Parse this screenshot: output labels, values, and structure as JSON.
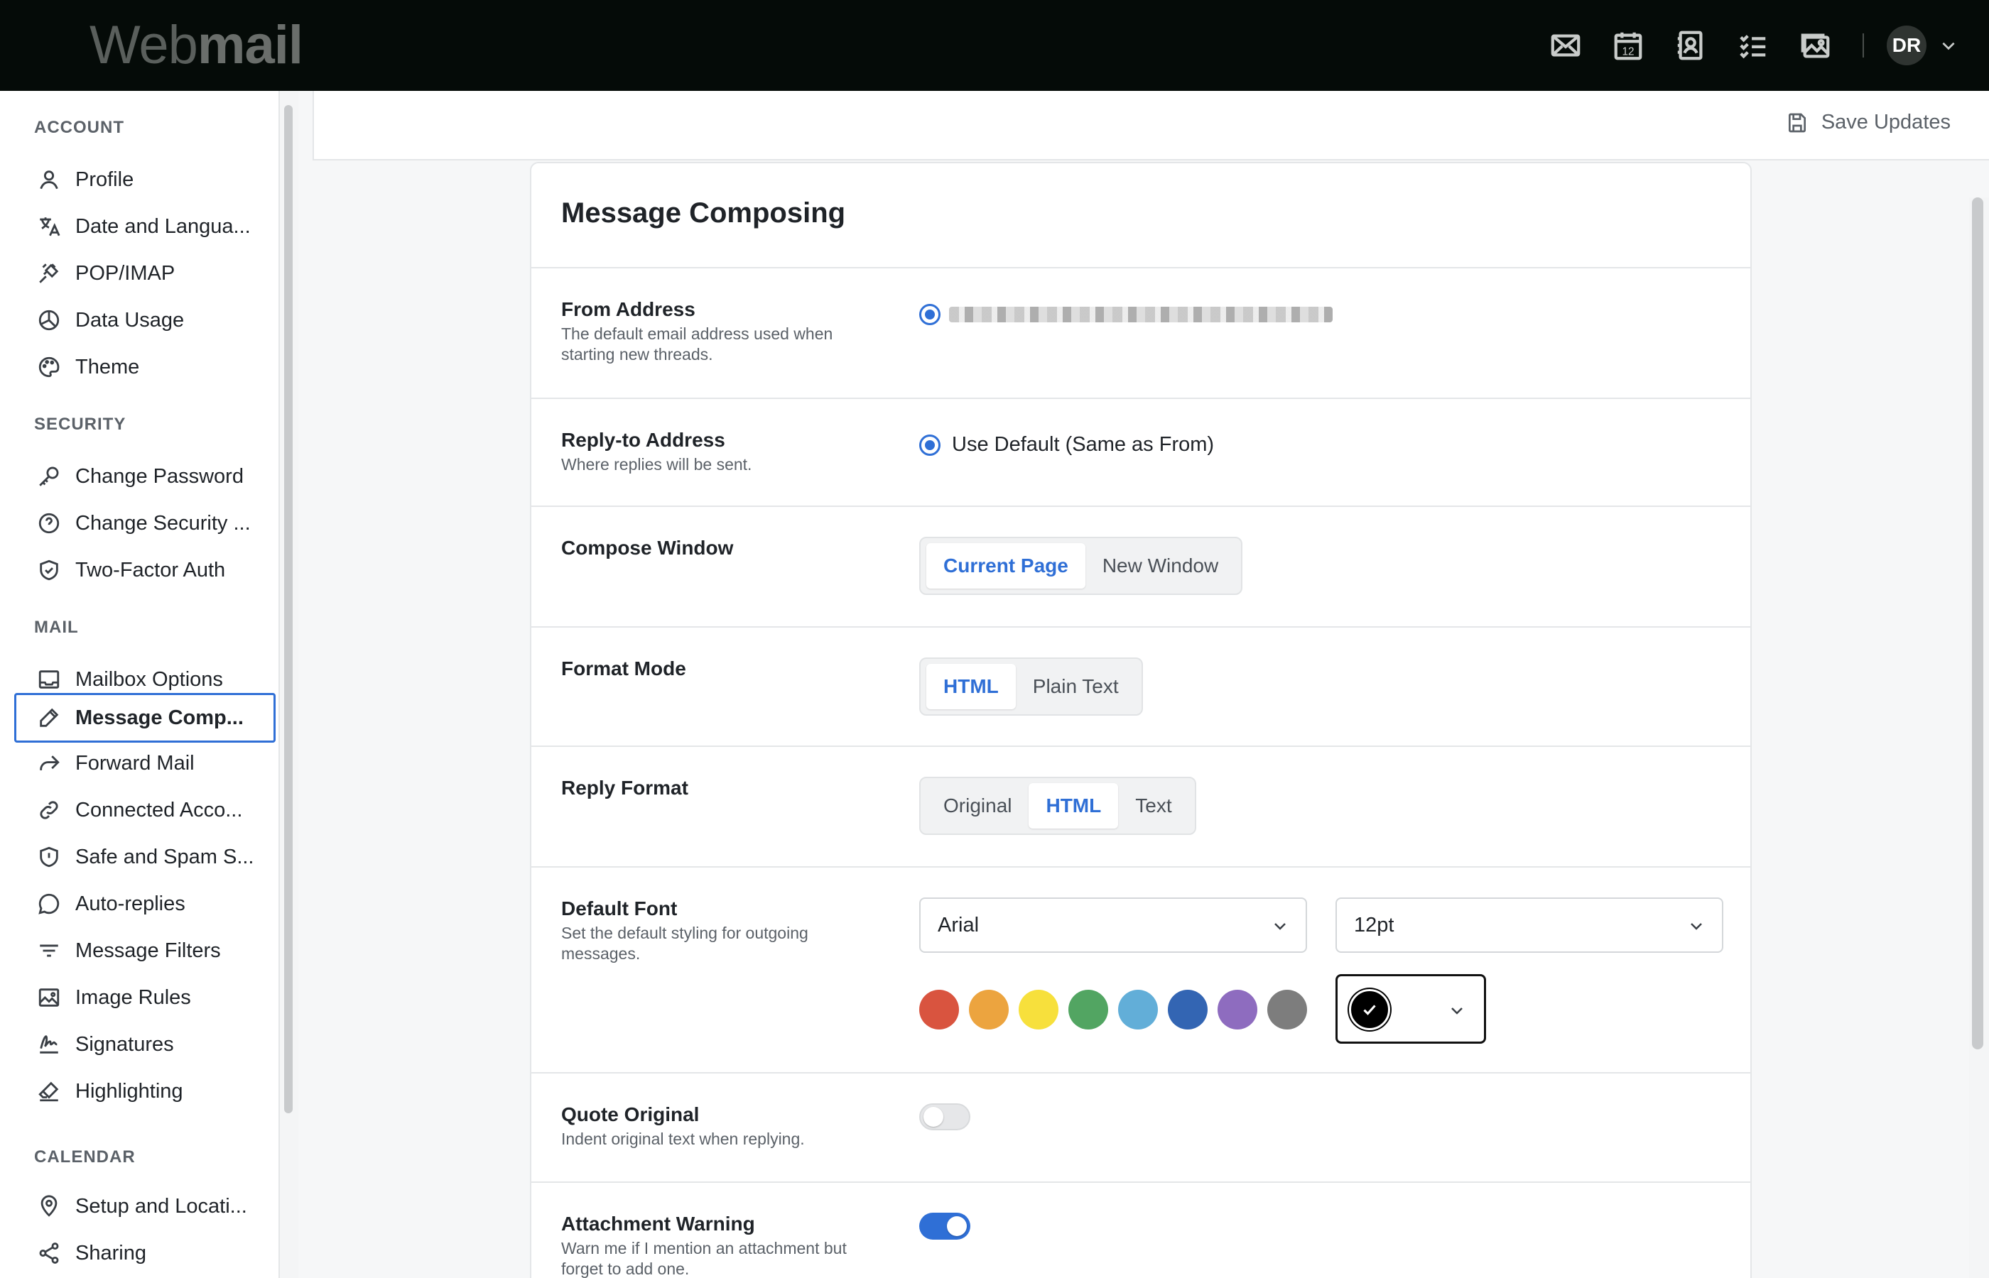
{
  "app": {
    "logo_web": "Web",
    "logo_mail": "mail",
    "top_icons": [
      "mail-icon",
      "calendar-icon",
      "contacts-icon",
      "tasks-icon",
      "photos-icon"
    ],
    "calendar_day": "12",
    "avatar_initials": "DR"
  },
  "toolbar": {
    "save_label": "Save Updates"
  },
  "sidebar": {
    "sections": [
      {
        "title": "ACCOUNT",
        "items": [
          {
            "label": "Profile",
            "icon": "user-icon"
          },
          {
            "label": "Date and Langua...",
            "icon": "translate-icon"
          },
          {
            "label": "POP/IMAP",
            "icon": "plug-icon"
          },
          {
            "label": "Data Usage",
            "icon": "pie-chart-icon"
          },
          {
            "label": "Theme",
            "icon": "palette-icon"
          }
        ]
      },
      {
        "title": "SECURITY",
        "items": [
          {
            "label": "Change Password",
            "icon": "key-icon"
          },
          {
            "label": "Change Security ...",
            "icon": "help-circle-icon"
          },
          {
            "label": "Two-Factor Auth",
            "icon": "shield-check-icon"
          }
        ]
      },
      {
        "title": "MAIL",
        "items": [
          {
            "label": "Mailbox Options",
            "icon": "inbox-icon"
          },
          {
            "label": "Message Comp...",
            "icon": "pencil-icon",
            "active": true
          },
          {
            "label": "Forward Mail",
            "icon": "forward-icon"
          },
          {
            "label": "Connected Acco...",
            "icon": "link-icon"
          },
          {
            "label": "Safe and Spam S...",
            "icon": "shield-alert-icon"
          },
          {
            "label": "Auto-replies",
            "icon": "chat-icon"
          },
          {
            "label": "Message Filters",
            "icon": "filter-icon"
          },
          {
            "label": "Image Rules",
            "icon": "image-icon"
          },
          {
            "label": "Signatures",
            "icon": "signature-icon"
          },
          {
            "label": "Highlighting",
            "icon": "highlighter-icon"
          }
        ]
      },
      {
        "title": "CALENDAR",
        "items": [
          {
            "label": "Setup and Locati...",
            "icon": "map-pin-icon"
          },
          {
            "label": "Sharing",
            "icon": "share-icon"
          }
        ]
      }
    ]
  },
  "settings": {
    "title": "Message Composing",
    "from_address": {
      "label": "From Address",
      "desc": "The default email address used when starting new threads."
    },
    "reply_to": {
      "label": "Reply-to Address",
      "desc": "Where replies will be sent.",
      "option": "Use Default (Same as From)"
    },
    "compose_window": {
      "label": "Compose Window",
      "options": [
        "Current Page",
        "New Window"
      ],
      "selected": 0
    },
    "format_mode": {
      "label": "Format Mode",
      "options": [
        "HTML",
        "Plain Text"
      ],
      "selected": 0
    },
    "reply_format": {
      "label": "Reply Format",
      "options": [
        "Original",
        "HTML",
        "Text"
      ],
      "selected": 1
    },
    "default_font": {
      "label": "Default Font",
      "desc": "Set the default styling for outgoing messages.",
      "font": "Arial",
      "size": "12pt",
      "swatches": [
        "#d9543f",
        "#eca43f",
        "#f7e03c",
        "#52a562",
        "#62aed8",
        "#3365b3",
        "#8e6cbf",
        "#7d7d7d"
      ],
      "selected_color": "#000000"
    },
    "quote_original": {
      "label": "Quote Original",
      "desc": "Indent original text when replying.",
      "enabled": false
    },
    "attachment_warning": {
      "label": "Attachment Warning",
      "desc": "Warn me if I mention an attachment but forget to add one.",
      "enabled": true
    }
  }
}
